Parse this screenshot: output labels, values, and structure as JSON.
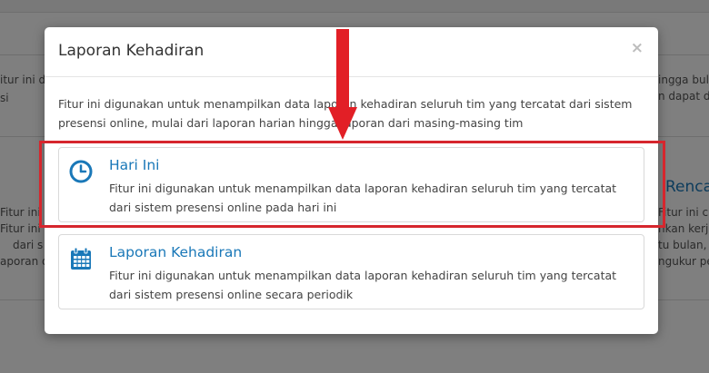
{
  "background": {
    "left_snippets": [
      "itur ini d",
      "si",
      "Fitur ini d",
      "Fitur ini d",
      "dari s",
      "aporan d"
    ],
    "right_snippets": [
      "ingga bula",
      "n dapat d",
      "Renca",
      "Fitur ini c",
      "nkan kerja",
      "tu bulan,",
      "ngukur pe"
    ]
  },
  "modal": {
    "title": "Laporan Kehadiran",
    "close": "×",
    "description": "Fitur ini digunakan untuk menampilkan data laporan kehadiran seluruh tim yang tercatat dari sistem presensi online, mulai dari laporan harian hingga laporan dari masing-masing tim",
    "options": [
      {
        "title": "Hari Ini",
        "description": "Fitur ini digunakan untuk menampilkan data laporan kehadiran seluruh tim yang tercatat dari sistem presensi online pada hari ini",
        "icon": "clock-icon"
      },
      {
        "title": "Laporan Kehadiran",
        "description": "Fitur ini digunakan untuk menampilkan data laporan kehadiran seluruh tim yang tercatat dari sistem presensi online secara periodik",
        "icon": "calendar-icon"
      }
    ]
  },
  "colors": {
    "accent": "#1a78b8",
    "annotation": "#d6262d"
  }
}
